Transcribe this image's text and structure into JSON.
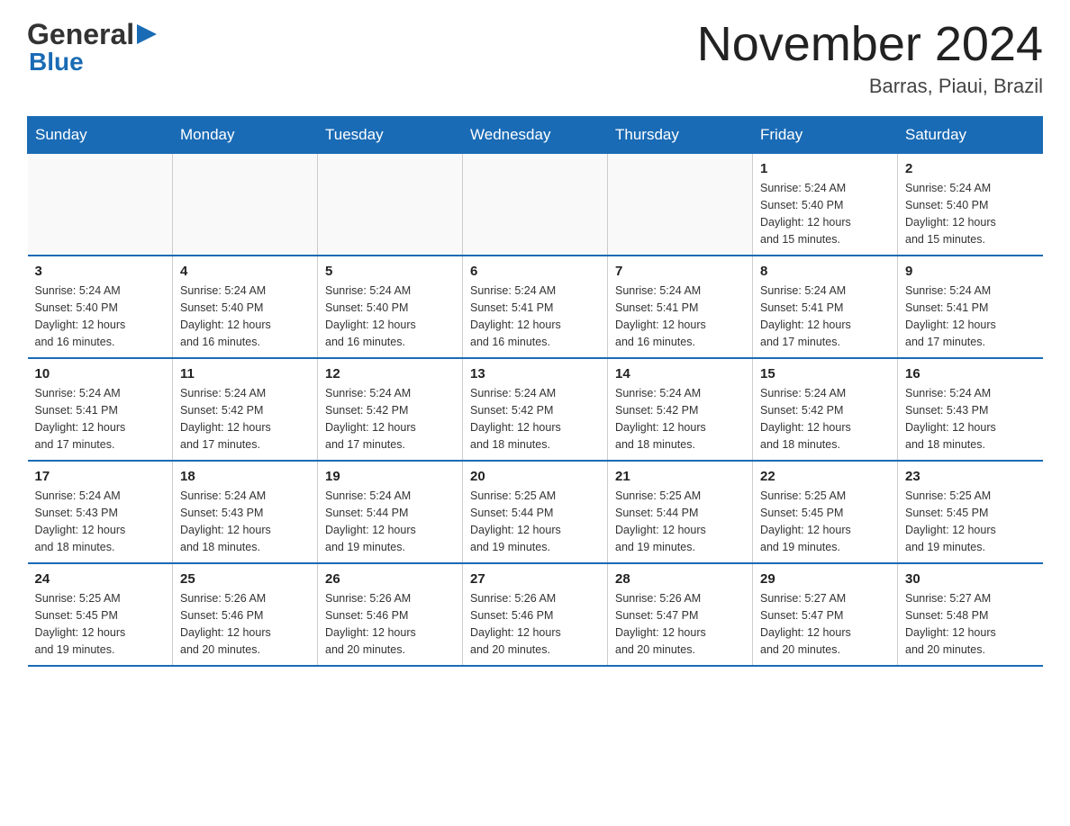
{
  "logo": {
    "text_general": "General",
    "triangle": "▶",
    "text_blue": "Blue"
  },
  "header": {
    "title": "November 2024",
    "subtitle": "Barras, Piaui, Brazil"
  },
  "weekdays": [
    "Sunday",
    "Monday",
    "Tuesday",
    "Wednesday",
    "Thursday",
    "Friday",
    "Saturday"
  ],
  "weeks": [
    [
      {
        "day": "",
        "info": ""
      },
      {
        "day": "",
        "info": ""
      },
      {
        "day": "",
        "info": ""
      },
      {
        "day": "",
        "info": ""
      },
      {
        "day": "",
        "info": ""
      },
      {
        "day": "1",
        "info": "Sunrise: 5:24 AM\nSunset: 5:40 PM\nDaylight: 12 hours\nand 15 minutes."
      },
      {
        "day": "2",
        "info": "Sunrise: 5:24 AM\nSunset: 5:40 PM\nDaylight: 12 hours\nand 15 minutes."
      }
    ],
    [
      {
        "day": "3",
        "info": "Sunrise: 5:24 AM\nSunset: 5:40 PM\nDaylight: 12 hours\nand 16 minutes."
      },
      {
        "day": "4",
        "info": "Sunrise: 5:24 AM\nSunset: 5:40 PM\nDaylight: 12 hours\nand 16 minutes."
      },
      {
        "day": "5",
        "info": "Sunrise: 5:24 AM\nSunset: 5:40 PM\nDaylight: 12 hours\nand 16 minutes."
      },
      {
        "day": "6",
        "info": "Sunrise: 5:24 AM\nSunset: 5:41 PM\nDaylight: 12 hours\nand 16 minutes."
      },
      {
        "day": "7",
        "info": "Sunrise: 5:24 AM\nSunset: 5:41 PM\nDaylight: 12 hours\nand 16 minutes."
      },
      {
        "day": "8",
        "info": "Sunrise: 5:24 AM\nSunset: 5:41 PM\nDaylight: 12 hours\nand 17 minutes."
      },
      {
        "day": "9",
        "info": "Sunrise: 5:24 AM\nSunset: 5:41 PM\nDaylight: 12 hours\nand 17 minutes."
      }
    ],
    [
      {
        "day": "10",
        "info": "Sunrise: 5:24 AM\nSunset: 5:41 PM\nDaylight: 12 hours\nand 17 minutes."
      },
      {
        "day": "11",
        "info": "Sunrise: 5:24 AM\nSunset: 5:42 PM\nDaylight: 12 hours\nand 17 minutes."
      },
      {
        "day": "12",
        "info": "Sunrise: 5:24 AM\nSunset: 5:42 PM\nDaylight: 12 hours\nand 17 minutes."
      },
      {
        "day": "13",
        "info": "Sunrise: 5:24 AM\nSunset: 5:42 PM\nDaylight: 12 hours\nand 18 minutes."
      },
      {
        "day": "14",
        "info": "Sunrise: 5:24 AM\nSunset: 5:42 PM\nDaylight: 12 hours\nand 18 minutes."
      },
      {
        "day": "15",
        "info": "Sunrise: 5:24 AM\nSunset: 5:42 PM\nDaylight: 12 hours\nand 18 minutes."
      },
      {
        "day": "16",
        "info": "Sunrise: 5:24 AM\nSunset: 5:43 PM\nDaylight: 12 hours\nand 18 minutes."
      }
    ],
    [
      {
        "day": "17",
        "info": "Sunrise: 5:24 AM\nSunset: 5:43 PM\nDaylight: 12 hours\nand 18 minutes."
      },
      {
        "day": "18",
        "info": "Sunrise: 5:24 AM\nSunset: 5:43 PM\nDaylight: 12 hours\nand 18 minutes."
      },
      {
        "day": "19",
        "info": "Sunrise: 5:24 AM\nSunset: 5:44 PM\nDaylight: 12 hours\nand 19 minutes."
      },
      {
        "day": "20",
        "info": "Sunrise: 5:25 AM\nSunset: 5:44 PM\nDaylight: 12 hours\nand 19 minutes."
      },
      {
        "day": "21",
        "info": "Sunrise: 5:25 AM\nSunset: 5:44 PM\nDaylight: 12 hours\nand 19 minutes."
      },
      {
        "day": "22",
        "info": "Sunrise: 5:25 AM\nSunset: 5:45 PM\nDaylight: 12 hours\nand 19 minutes."
      },
      {
        "day": "23",
        "info": "Sunrise: 5:25 AM\nSunset: 5:45 PM\nDaylight: 12 hours\nand 19 minutes."
      }
    ],
    [
      {
        "day": "24",
        "info": "Sunrise: 5:25 AM\nSunset: 5:45 PM\nDaylight: 12 hours\nand 19 minutes."
      },
      {
        "day": "25",
        "info": "Sunrise: 5:26 AM\nSunset: 5:46 PM\nDaylight: 12 hours\nand 20 minutes."
      },
      {
        "day": "26",
        "info": "Sunrise: 5:26 AM\nSunset: 5:46 PM\nDaylight: 12 hours\nand 20 minutes."
      },
      {
        "day": "27",
        "info": "Sunrise: 5:26 AM\nSunset: 5:46 PM\nDaylight: 12 hours\nand 20 minutes."
      },
      {
        "day": "28",
        "info": "Sunrise: 5:26 AM\nSunset: 5:47 PM\nDaylight: 12 hours\nand 20 minutes."
      },
      {
        "day": "29",
        "info": "Sunrise: 5:27 AM\nSunset: 5:47 PM\nDaylight: 12 hours\nand 20 minutes."
      },
      {
        "day": "30",
        "info": "Sunrise: 5:27 AM\nSunset: 5:48 PM\nDaylight: 12 hours\nand 20 minutes."
      }
    ]
  ]
}
